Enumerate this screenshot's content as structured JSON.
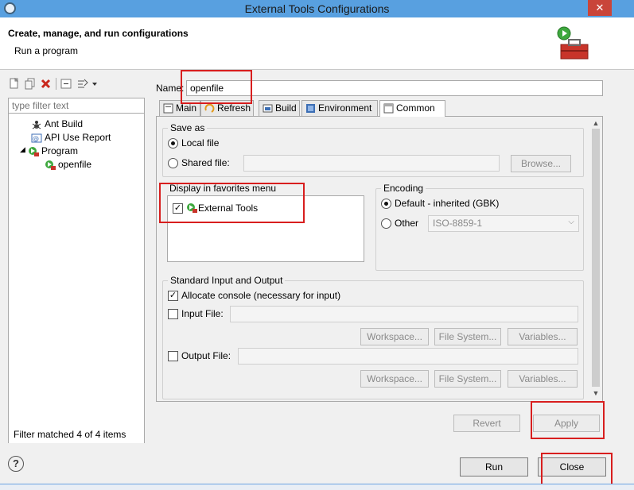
{
  "window": {
    "title": "External Tools Configurations",
    "close_glyph": "✕"
  },
  "header": {
    "title": "Create, manage, and run configurations",
    "subtitle": "Run a program"
  },
  "left": {
    "filter_placeholder": "type filter text",
    "tree": [
      {
        "label": "Ant Build",
        "icon": "ant-icon"
      },
      {
        "label": "API Use Report",
        "icon": "api-report-icon"
      },
      {
        "label": "Program",
        "icon": "program-icon",
        "expanded": true
      },
      {
        "label": "openfile",
        "icon": "program-launch-icon"
      }
    ],
    "status": "Filter matched 4 of 4 items"
  },
  "name": {
    "label": "Name:",
    "value": "openfile"
  },
  "tabs": [
    {
      "label": "Main",
      "icon": "main-tab-icon"
    },
    {
      "label": "Refresh",
      "icon": "refresh-tab-icon"
    },
    {
      "label": "Build",
      "icon": "build-tab-icon"
    },
    {
      "label": "Environment",
      "icon": "environment-tab-icon"
    },
    {
      "label": "Common",
      "icon": "common-tab-icon",
      "active": true
    }
  ],
  "save_as": {
    "title": "Save as",
    "local_label": "Local file",
    "shared_label": "Shared file:",
    "shared_value": "",
    "browse_label": "Browse..."
  },
  "favorites": {
    "title": "Display in favorites menu",
    "items": [
      {
        "label": "External Tools",
        "checked": true
      }
    ]
  },
  "encoding": {
    "title": "Encoding",
    "default_label": "Default - inherited (GBK)",
    "other_label": "Other",
    "other_value": "ISO-8859-1"
  },
  "std_io": {
    "title": "Standard Input and Output",
    "allocate_label": "Allocate console (necessary for input)",
    "input_label": "Input File:",
    "output_label": "Output File:",
    "workspace_label": "Workspace...",
    "filesystem_label": "File System...",
    "variables_label": "Variables..."
  },
  "buttons": {
    "revert": "Revert",
    "apply": "Apply",
    "run": "Run",
    "close": "Close"
  },
  "check_mark": "✓",
  "help_glyph": "?"
}
